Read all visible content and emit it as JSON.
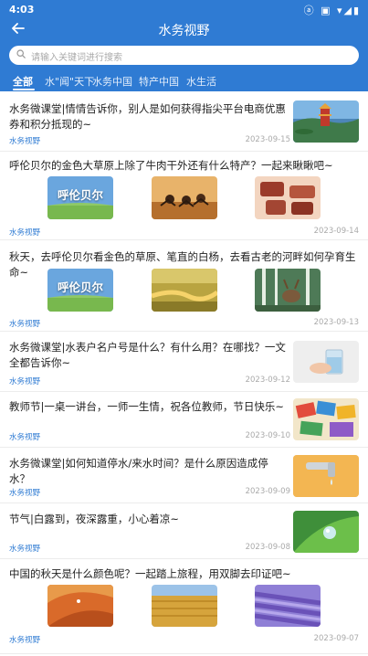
{
  "status_bar": {
    "time": "4:03",
    "icons": "ⓐ ▣ ▾◢▮"
  },
  "header": {
    "title": "水务视野",
    "back_icon": "arrow-left-icon"
  },
  "search": {
    "placeholder": "请输入关键词进行搜索"
  },
  "tabs": [
    {
      "label": "全部",
      "active": true
    },
    {
      "label": "水\"闻\"天下",
      "active": false
    },
    {
      "label": "水务中国",
      "active": false
    },
    {
      "label": "特产中国",
      "active": false
    },
    {
      "label": "水生活",
      "active": false
    }
  ],
  "thumb_caption": "呼伦贝尔",
  "articles": [
    {
      "title": "水务微课堂|情情告诉你，别人是如何获得指尖平台电商优惠券和积分抵现的~",
      "source": "水务视野",
      "date": "2023-09-15",
      "image": "lake-pagoda"
    },
    {
      "title": "呼伦贝尔的金色大草原上除了牛肉干外还有什么特产？一起来瞅瞅吧~",
      "source": "水务视野",
      "date": "2023-09-14",
      "images": [
        "hulunbuir-banner",
        "horse-race",
        "dried-meat"
      ]
    },
    {
      "title": "秋天，去呼伦贝尔看金色的草原、笔直的白杨，去看古老的河畔如何孕育生命~",
      "source": "水务视野",
      "date": "2023-09-13",
      "images": [
        "hulunbuir-banner",
        "golden-river",
        "reindeer-forest"
      ]
    },
    {
      "title": "水务微课堂|水表户名户号是什么？有什么用？在哪找？一文全都告诉你~",
      "source": "水务视野",
      "date": "2023-09-12",
      "image": "water-glass"
    },
    {
      "title": "教师节|一桌一讲台，一师一生情，祝各位教师，节日快乐~",
      "source": "水务视野",
      "date": "2023-09-10",
      "image": "classroom"
    },
    {
      "title": "水务微课堂|如何知道停水/来水时间？是什么原因造成停水？",
      "source": "水务视野",
      "date": "2023-09-09",
      "image": "faucet"
    },
    {
      "title": "节气|白露到，夜深露重，小心着凉~",
      "source": "水务视野",
      "date": "2023-09-08",
      "image": "dewdrop"
    },
    {
      "title": "中国的秋天是什么颜色呢？一起踏上旅程，用双脚去印证吧~",
      "source": "水务视野",
      "date": "2023-09-07",
      "images": [
        "autumn-field",
        "wheat-field",
        "lavender-field"
      ]
    }
  ]
}
